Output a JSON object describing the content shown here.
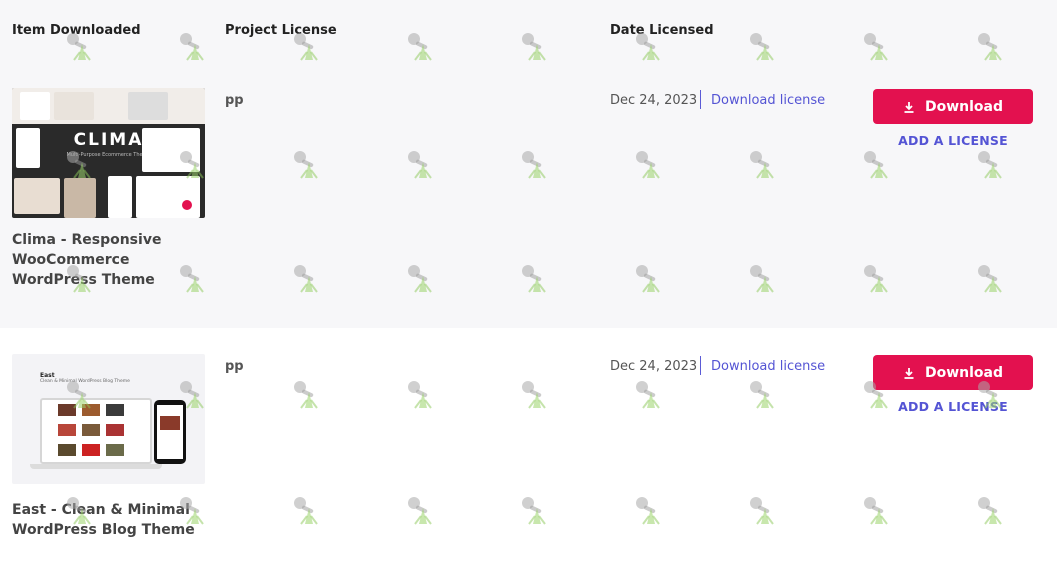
{
  "header": {
    "col_item": "Item Downloaded",
    "col_project": "Project License",
    "col_date": "Date Licensed"
  },
  "items": [
    {
      "title": "Clima - Responsive WooCommerce WordPress Theme",
      "thumb_brand": "CLIMA",
      "thumb_sub": "Multi-Purpose Ecommerce Theme",
      "project": "pp",
      "date": "Dec 24, 2023",
      "download_license": "Download license",
      "download": "Download",
      "add_license": "ADD A LICENSE"
    },
    {
      "title": "East - Clean & Minimal WordPress Blog Theme",
      "thumb_brand": "East",
      "thumb_sub": "Clean & Minimal WordPress Blog Theme",
      "project": "pp",
      "date": "Dec 24, 2023",
      "download_license": "Download license",
      "download": "Download",
      "add_license": "ADD A LICENSE"
    }
  ],
  "colors": {
    "accent": "#e3114f",
    "link": "#5454d4",
    "row_alt": "#f7f7f9"
  },
  "icons": {
    "download": "download-arrow-icon",
    "watermark": "watermark-icon"
  }
}
